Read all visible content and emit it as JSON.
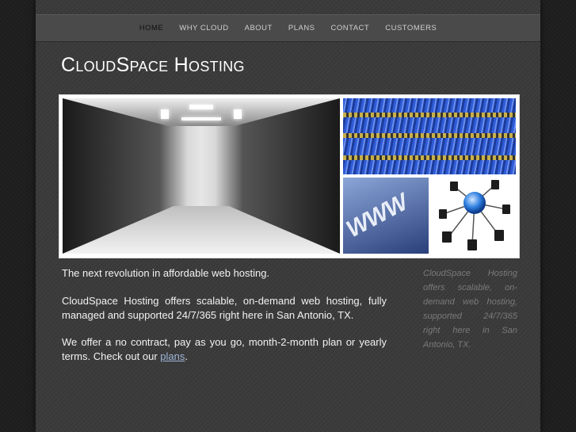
{
  "nav": {
    "items": [
      {
        "label": "HOME",
        "active": true
      },
      {
        "label": "WHY CLOUD"
      },
      {
        "label": "ABOUT"
      },
      {
        "label": "PLANS"
      },
      {
        "label": "CONTACT"
      },
      {
        "label": "CUSTOMERS"
      }
    ]
  },
  "site": {
    "title": "CloudSpace Hosting"
  },
  "banner": {
    "www_text": "WWW"
  },
  "content": {
    "tagline": "The next revolution in affordable web hosting.",
    "para1": "CloudSpace Hosting offers scalable, on-demand web hosting, fully managed and supported 24/7/365 right here in San Antonio, TX.",
    "para2_prefix": "We offer a no contract, pay as you go, month-2-month plan or yearly terms. Check out our ",
    "para2_link": "plans",
    "para2_suffix": "."
  },
  "sidebar": {
    "text": "CloudSpace Hosting offers scalable, on-demand web hosting, supported 24/7/365 right here in San Antonio, TX."
  },
  "colors": {
    "page_bg": "#3a3a3a",
    "nav_bg": "#4a4a4a",
    "link": "#9fb6d9",
    "side_text": "#7a7a7a"
  }
}
